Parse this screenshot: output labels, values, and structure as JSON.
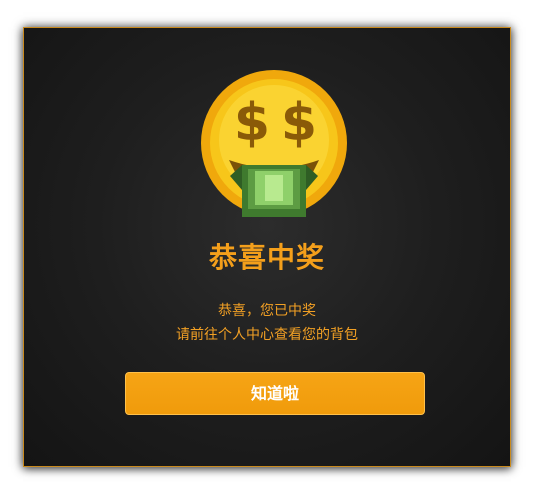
{
  "dialog": {
    "title": "恭喜中奖",
    "message_line1": "恭喜，您已中奖",
    "message_line2": "请前往个人中心查看您的背包",
    "confirm_label": "知道啦",
    "icon": "money-mouth-face-icon"
  },
  "colors": {
    "accent": "#f49f1b",
    "button_bg": "#f39f10",
    "modal_bg": "#1e1e1e",
    "modal_border": "#c98a1e",
    "coin_gold": "#f5c216",
    "banknote_green": "#4f8a3a"
  }
}
